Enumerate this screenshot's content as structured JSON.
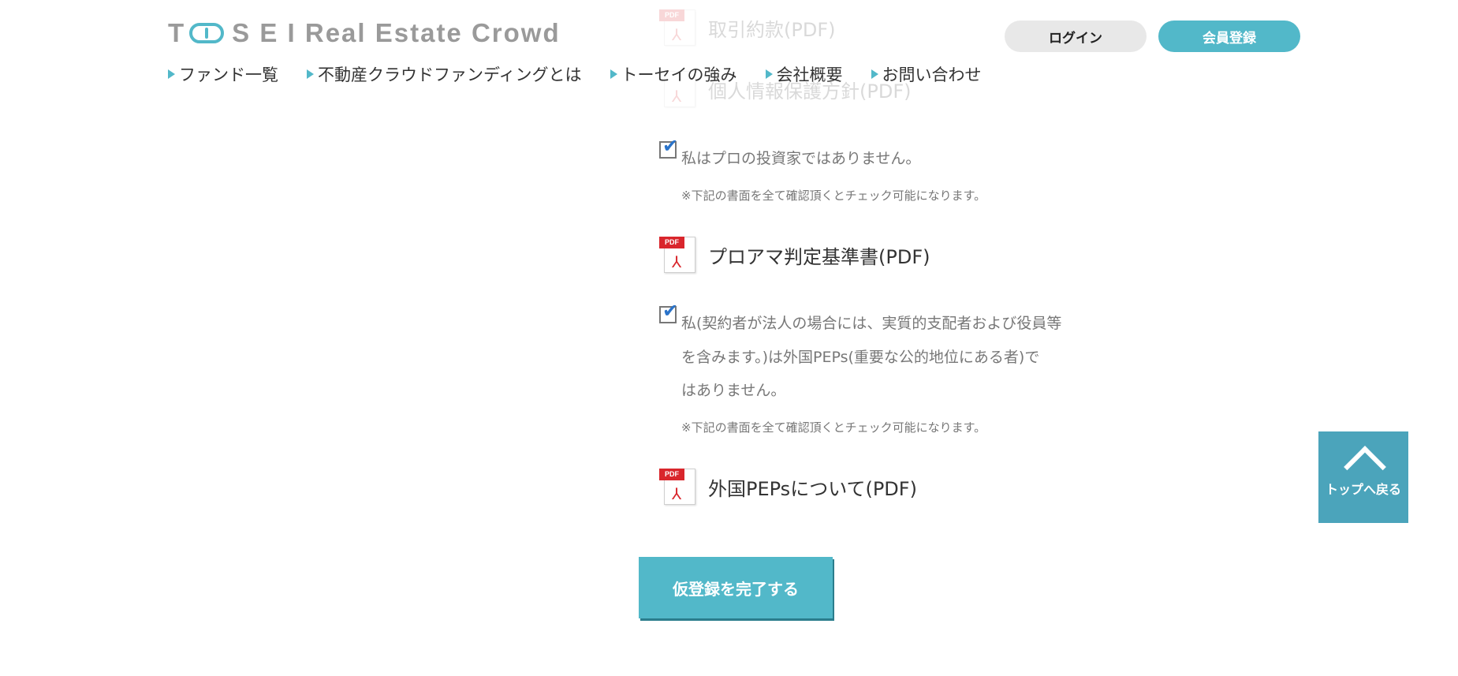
{
  "header": {
    "logo_t": "T",
    "logo_rest": "S E I Real Estate Crowd",
    "login_label": "ログイン",
    "register_label": "会員登録",
    "nav": [
      {
        "label": "ファンド一覧"
      },
      {
        "label": "不動産クラウドファンディングとは"
      },
      {
        "label": "トーセイの強み"
      },
      {
        "label": "会社概要"
      },
      {
        "label": "お問い合わせ"
      }
    ]
  },
  "documents": {
    "faded_1": "取引約款(PDF)",
    "faded_2": "個人情報保護方針(PDF)",
    "pro_check": "私はプロの投資家ではありません。",
    "pro_note": "※下記の書面を全て確認頂くとチェック可能になります。",
    "pro_pdf": "プロアマ判定基準書(PDF)",
    "peps_check_1": "私(契約者が法人の場合には、実質的支配者および役員等",
    "peps_check_2": "を含みます。)は外国PEPs(重要な公的地位にある者)で",
    "peps_check_3": "はありません。",
    "peps_note": "※下記の書面を全て確認頂くとチェック可能になります。",
    "peps_pdf": "外国PEPsについて(PDF)"
  },
  "pdf_tag": "PDF",
  "submit_label": "仮登録を完了する",
  "back_to_top_label": "トップへ戻る",
  "colors": {
    "accent": "#52b8c9",
    "back_top": "#4ba4bb",
    "pdf_red": "#d9262c",
    "check_blue": "#2a73c9"
  }
}
